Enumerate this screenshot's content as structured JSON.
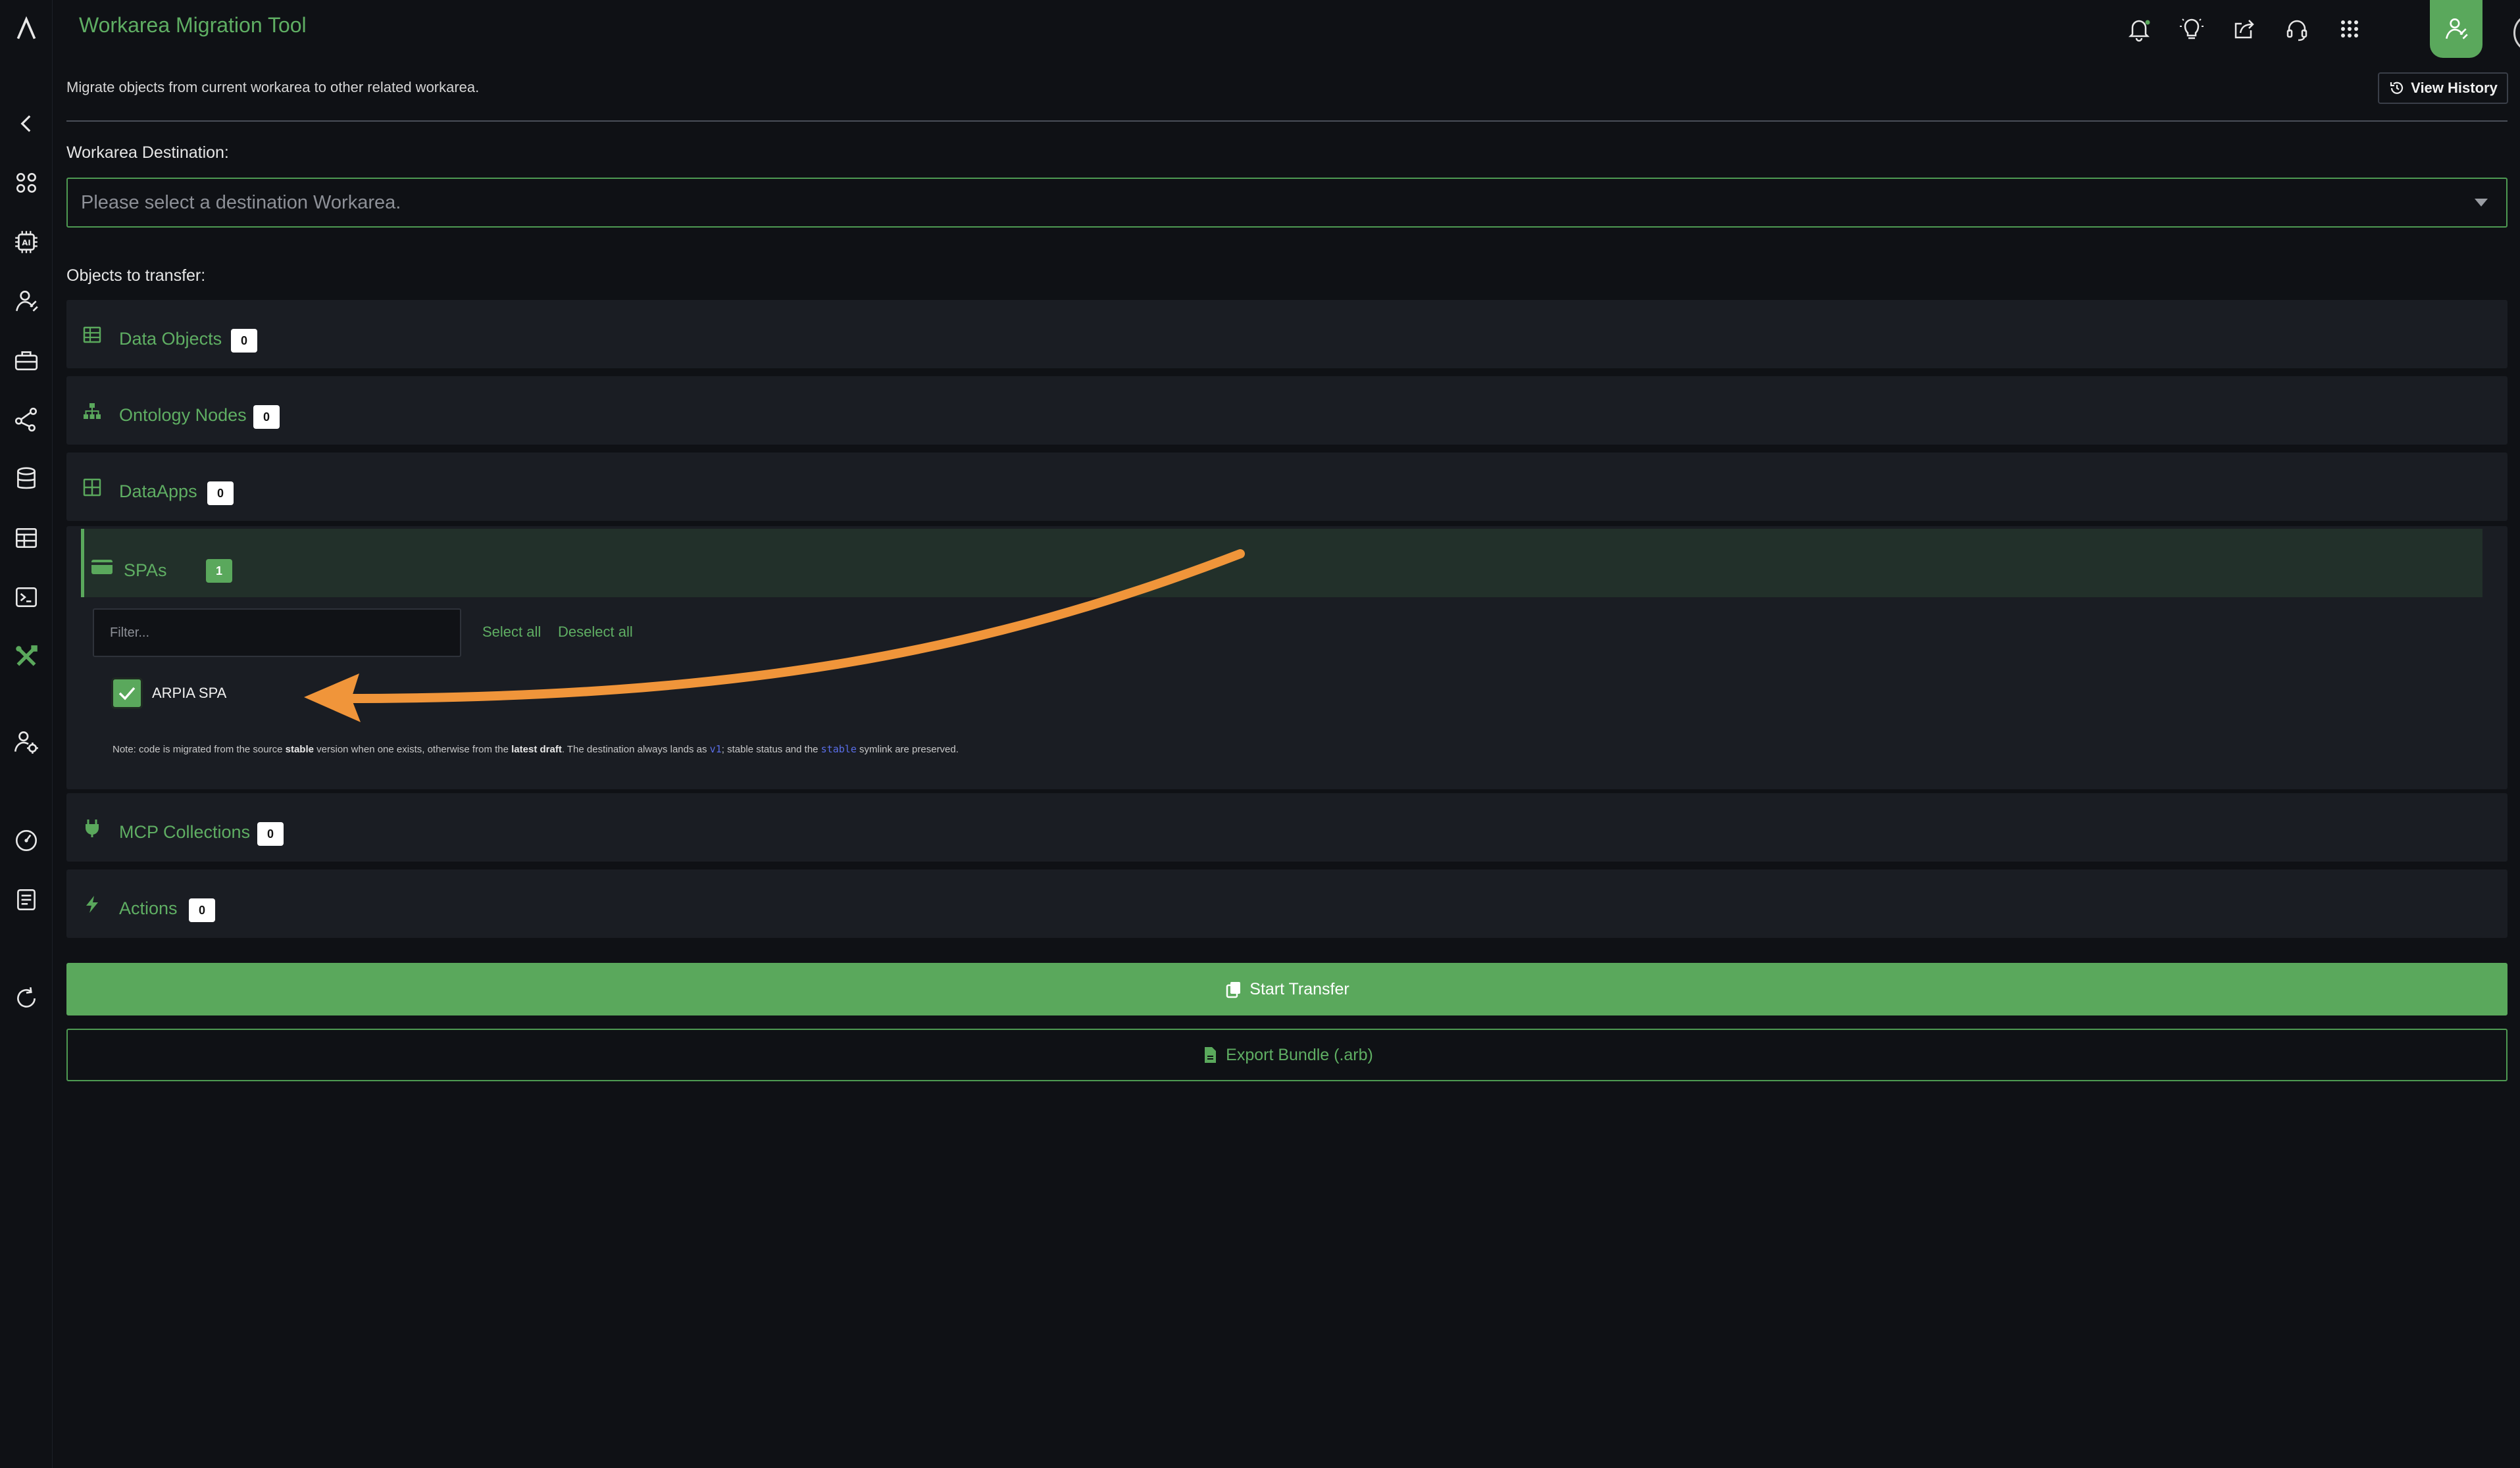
{
  "header": {
    "title": "Workarea Migration Tool"
  },
  "page": {
    "subtitle": "Migrate objects from current workarea to other related workarea.",
    "view_history_label": "View History",
    "destination_label": "Workarea Destination:",
    "destination_placeholder": "Please select a destination Workarea.",
    "objects_label": "Objects to transfer:"
  },
  "sections": [
    {
      "label": "Data Objects",
      "count": "0",
      "icon": "table-icon"
    },
    {
      "label": "Ontology Nodes",
      "count": "0",
      "icon": "hierarchy-icon"
    },
    {
      "label": "DataApps",
      "count": "0",
      "icon": "grid-icon"
    },
    {
      "label": "SPAs",
      "count": "1",
      "icon": "card-icon"
    },
    {
      "label": "MCP Collections",
      "count": "0",
      "icon": "plug-icon"
    },
    {
      "label": "Actions",
      "count": "0",
      "icon": "bolt-icon"
    }
  ],
  "spa_panel": {
    "filter_placeholder": "Filter...",
    "select_all": "Select all",
    "deselect_all": "Deselect all",
    "item_label": "ARPIA SPA",
    "note_part1": "Note: code is migrated from the source ",
    "note_bold1": "stable",
    "note_part2": " version when one exists, otherwise from the ",
    "note_bold2": "latest draft",
    "note_part3": ". The destination always lands as ",
    "note_code1": "v1",
    "note_part4": "; stable status and the ",
    "note_code2": "stable",
    "note_part5": " symlink are preserved."
  },
  "actions": {
    "start_transfer": "Start Transfer",
    "export_bundle": "Export Bundle (.arb)"
  },
  "colors": {
    "accent": "#5aa85c",
    "background": "#0f1115",
    "panel": "#1a1d23",
    "annotation_arrow": "#f0953a"
  }
}
